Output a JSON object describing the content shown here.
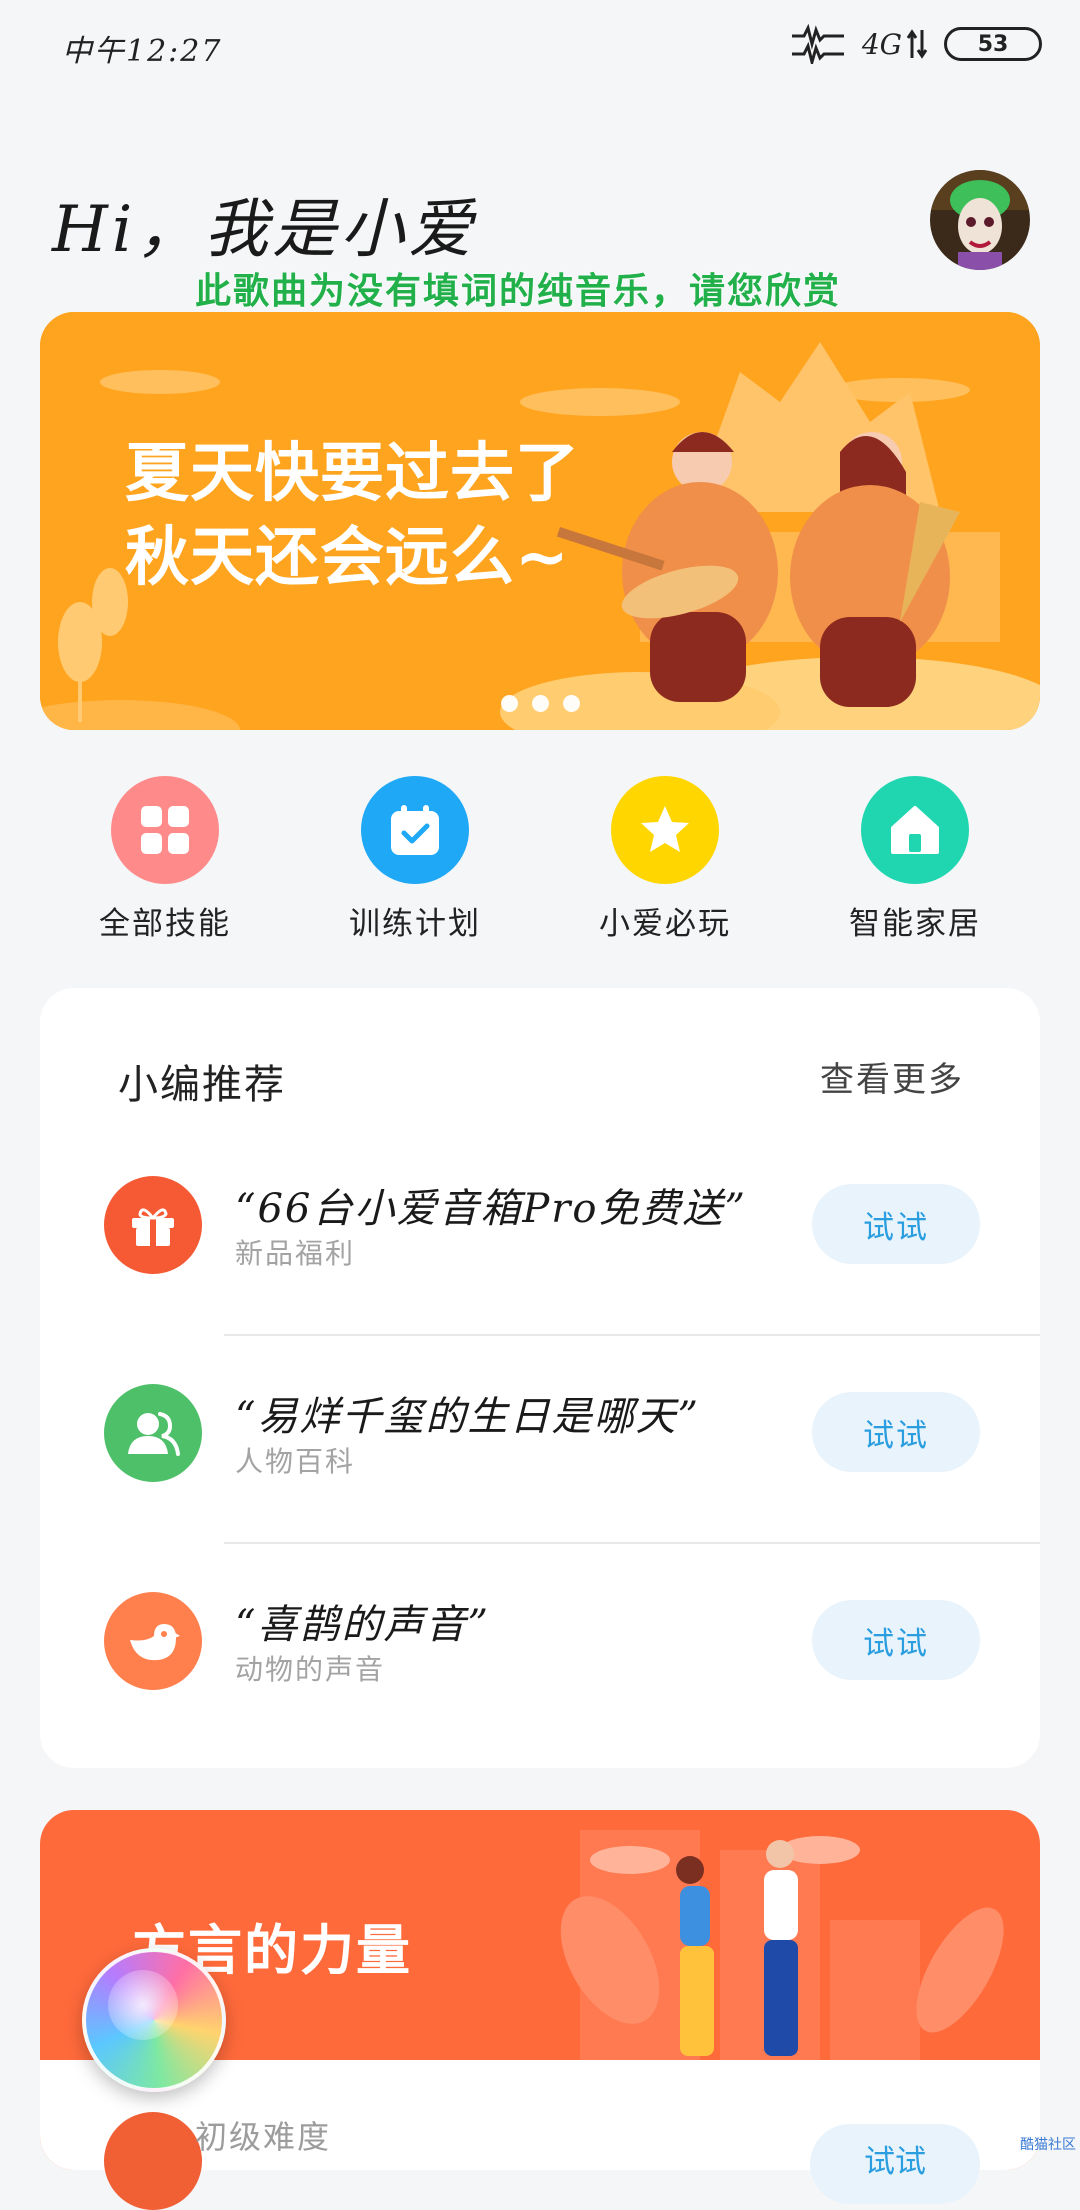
{
  "status_bar": {
    "time": "中午12:27",
    "network": "4G",
    "battery": "53"
  },
  "header": {
    "greeting": "Hi，我是小爱",
    "lyric_overlay": "此歌曲为没有填词的纯音乐，请您欣赏"
  },
  "banner": {
    "line1": "夏天快要过去了",
    "line2": "秋天还会远么~",
    "active_dot": 0,
    "dot_count": 3
  },
  "quick_actions": [
    {
      "label": "全部技能",
      "icon": "grid-icon",
      "color": "#ff8a8a"
    },
    {
      "label": "训练计划",
      "icon": "calendar-check-icon",
      "color": "#1fa8f5"
    },
    {
      "label": "小爱必玩",
      "icon": "star-icon",
      "color": "#ffd600"
    },
    {
      "label": "智能家居",
      "icon": "home-icon",
      "color": "#1fd6b0"
    }
  ],
  "recommend": {
    "title": "小编推荐",
    "more": "查看更多",
    "items": [
      {
        "query": "“66台小爱音箱Pro免费送”",
        "category": "新品福利",
        "button": "试试",
        "icon": "gift-icon",
        "color": "#f55a35"
      },
      {
        "query": "“易烊千玺的生日是哪天”",
        "category": "人物百科",
        "button": "试试",
        "icon": "people-icon",
        "color": "#4fc06a"
      },
      {
        "query": "“喜鹊的声音”",
        "category": "动物的声音",
        "button": "试试",
        "icon": "bird-icon",
        "color": "#ff7f4d"
      }
    ]
  },
  "dialect": {
    "title": "方言的力量",
    "level": "初级难度",
    "button": "试试"
  },
  "watermark": "酷猫社区"
}
